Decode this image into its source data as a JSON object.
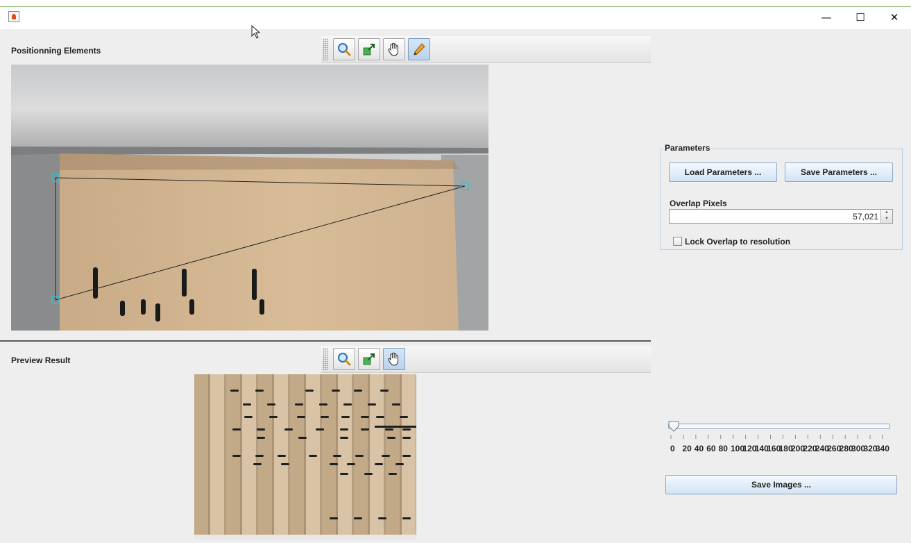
{
  "window": {
    "title": "",
    "minimize_icon": "minimize-icon",
    "maximize_icon": "maximize-icon",
    "close_icon": "close-icon",
    "minimize_glyph": "—",
    "maximize_glyph": "☐",
    "close_glyph": "✕"
  },
  "positioning": {
    "label": "Positionning Elements",
    "toolbar": [
      {
        "icon": "zoom-icon",
        "active": false
      },
      {
        "icon": "fit-icon",
        "active": false
      },
      {
        "icon": "pan-hand-icon",
        "active": false
      },
      {
        "icon": "pencil-icon",
        "active": true
      }
    ]
  },
  "preview": {
    "label": "Preview Result",
    "toolbar": [
      {
        "icon": "zoom-icon",
        "active": false
      },
      {
        "icon": "fit-icon",
        "active": false
      },
      {
        "icon": "pan-hand-icon",
        "active": true
      }
    ]
  },
  "parameters": {
    "title": "Parameters",
    "load_label": "Load Parameters ...",
    "save_label": "Save Parameters ...",
    "overlap_label": "Overlap Pixels",
    "overlap_value": "57,021",
    "lock_label": "Lock Overlap to resolution",
    "lock_checked": false
  },
  "slider": {
    "value": 0,
    "min": 0,
    "max": 340,
    "tick_labels": [
      "0",
      "20",
      "40",
      "60",
      "80",
      "100",
      "120",
      "140",
      "160",
      "180",
      "200",
      "220",
      "240",
      "260",
      "280",
      "300",
      "320",
      "340"
    ]
  },
  "save_images_label": "Save Images ...",
  "colors": {
    "accent_line": "#8fc27a",
    "marker": "#22c8d8",
    "button_gradient_top": "#f4f9ff",
    "button_gradient_bottom": "#d2e3f4"
  }
}
